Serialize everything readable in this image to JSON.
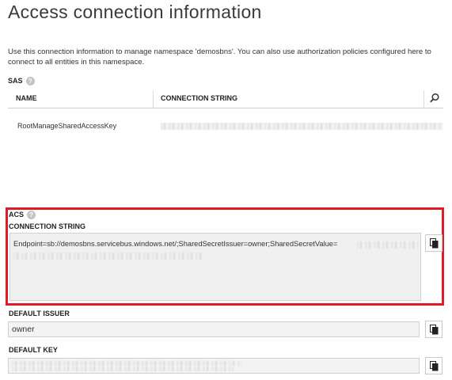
{
  "page": {
    "title": "Access connection information",
    "description": "Use this connection information to manage namespace 'demosbns'. You can also use authorization policies configured here to connect to all entities in this namespace."
  },
  "sas": {
    "label": "SAS",
    "columns": [
      "NAME",
      "CONNECTION STRING"
    ],
    "rows": [
      {
        "name": "RootManageSharedAccessKey"
      }
    ]
  },
  "acs": {
    "label": "ACS",
    "connection_string_label": "CONNECTION STRING",
    "connection_string": "Endpoint=sb://demosbns.servicebus.windows.net/;SharedSecretIssuer=owner;SharedSecretValue=",
    "default_issuer_label": "DEFAULT ISSUER",
    "default_issuer_value": "owner",
    "default_key_label": "DEFAULT KEY"
  },
  "icons": {
    "help": "question-mark-icon",
    "search": "search-icon",
    "copy": "copy-icon"
  },
  "colors": {
    "highlight": "#e11a27",
    "field_bg": "#f0f0f0"
  }
}
